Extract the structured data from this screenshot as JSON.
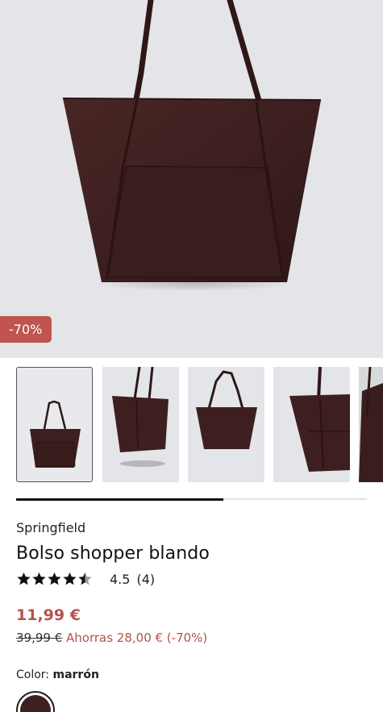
{
  "product": {
    "discount_badge": "-70%",
    "brand": "Springfield",
    "title": "Bolso shopper blando",
    "rating_value": "4.5",
    "rating_count": "(4)",
    "rating_stars": 4.5,
    "price": "11,99 €",
    "old_price": "39,99 €",
    "savings": "Ahorras 28,00 € (-70%)",
    "color_label": "Color:",
    "color_value": "marrón",
    "color_hex": "#3f2020"
  },
  "gallery": {
    "thumbnail_count": 5,
    "active_index": 0,
    "scroll_progress": 0.59
  },
  "icons": {
    "star": "star-icon",
    "half_star": "half-star-icon"
  },
  "colors": {
    "accent": "#b5524d",
    "badge_bg": "#c0544f",
    "bag_brown": "#3f2020",
    "image_bg": "#e4e5e9"
  }
}
